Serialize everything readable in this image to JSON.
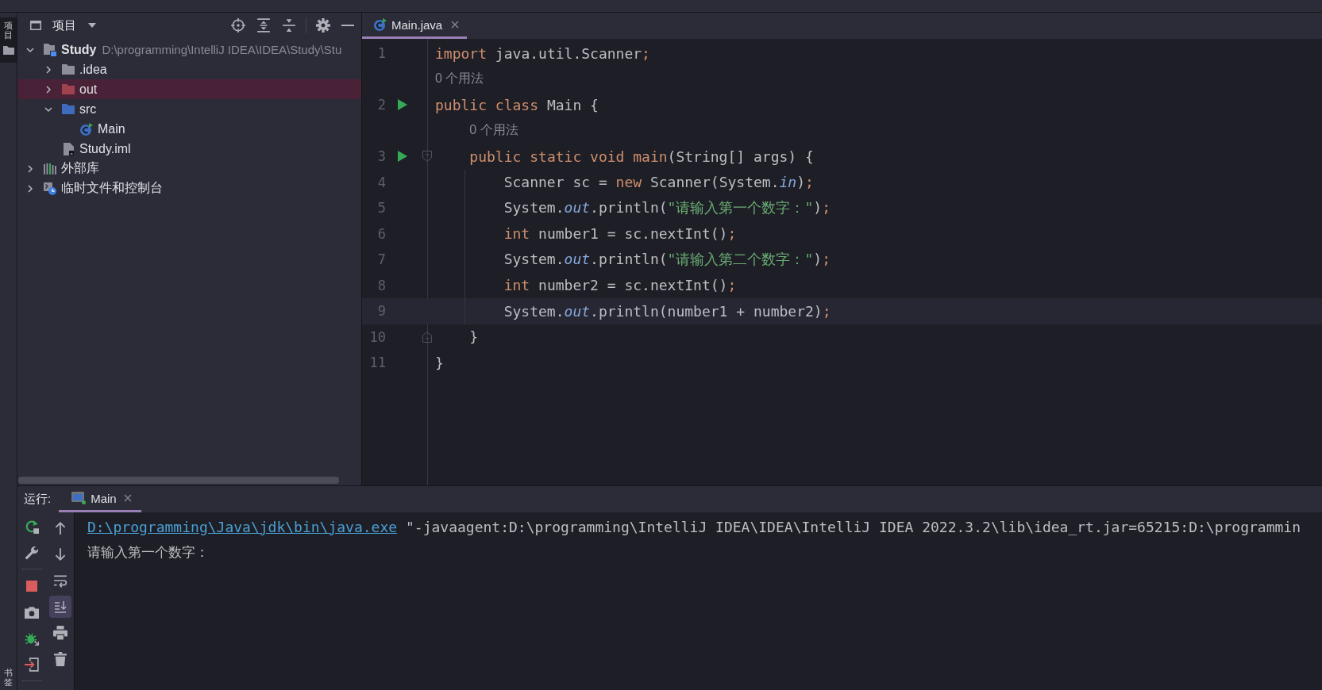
{
  "left_stripe": {
    "project_button": {
      "label": "项目",
      "selected": true
    },
    "bookmarks_button": {
      "label": "书签"
    }
  },
  "project_panel": {
    "title": "项目",
    "tree": [
      {
        "kind": "module",
        "label": "Study",
        "detail": "D:\\programming\\IntelliJ IDEA\\IDEA\\Study\\Stu",
        "expanded": true,
        "selected": false,
        "children": [
          {
            "kind": "folder",
            "label": ".idea",
            "expanded": false,
            "selected": false
          },
          {
            "kind": "excluded-folder",
            "label": "out",
            "expanded": false,
            "selected": true
          },
          {
            "kind": "source-folder",
            "label": "src",
            "expanded": true,
            "selected": false,
            "children": [
              {
                "kind": "class",
                "label": "Main",
                "selected": false
              }
            ]
          },
          {
            "kind": "module-file",
            "label": "Study.iml",
            "selected": false
          }
        ]
      },
      {
        "kind": "libraries",
        "label": "外部库",
        "expanded": false,
        "selected": false
      },
      {
        "kind": "scratches",
        "label": "临时文件和控制台",
        "expanded": false,
        "selected": false
      }
    ]
  },
  "editor": {
    "tabs": [
      {
        "label": "Main.java",
        "selected": true
      }
    ],
    "lines": [
      {
        "kind": "code",
        "number": "1",
        "run": false,
        "current": false,
        "fold_start": false,
        "fold_end": false,
        "tokens": [
          {
            "kind": "keyword",
            "text": "import"
          },
          {
            "kind": "plain",
            "text": " java.util.Scanner"
          },
          {
            "kind": "punct",
            "text": ";"
          }
        ]
      },
      {
        "kind": "hint",
        "text": "0 个用法"
      },
      {
        "kind": "code",
        "number": "2",
        "run": true,
        "current": false,
        "fold_start": false,
        "fold_end": false,
        "tokens": [
          {
            "kind": "keyword",
            "text": "public class"
          },
          {
            "kind": "plain",
            "text": " Main {"
          }
        ],
        "children": [
          {
            "kind": "hint",
            "text": "0 个用法"
          },
          {
            "kind": "code",
            "number": "3",
            "run": true,
            "current": false,
            "fold_start": true,
            "fold_end": false,
            "tokens": [
              {
                "kind": "keyword",
                "text": "public static void main"
              },
              {
                "kind": "plain",
                "text": "(String[] args) {"
              }
            ],
            "children": [
              {
                "kind": "code",
                "number": "4",
                "run": false,
                "current": false,
                "fold_start": false,
                "fold_end": false,
                "tokens": [
                  {
                    "kind": "plain",
                    "text": "Scanner sc = "
                  },
                  {
                    "kind": "keyword",
                    "text": "new"
                  },
                  {
                    "kind": "plain",
                    "text": " Scanner(System."
                  },
                  {
                    "kind": "field",
                    "text": "in"
                  },
                  {
                    "kind": "plain",
                    "text": ")"
                  },
                  {
                    "kind": "punct",
                    "text": ";"
                  }
                ]
              },
              {
                "kind": "code",
                "number": "5",
                "run": false,
                "current": false,
                "fold_start": false,
                "fold_end": false,
                "tokens": [
                  {
                    "kind": "plain",
                    "text": "System."
                  },
                  {
                    "kind": "field",
                    "text": "out"
                  },
                  {
                    "kind": "plain",
                    "text": ".println("
                  },
                  {
                    "kind": "string",
                    "text": "\"请输入第一个数字：\""
                  },
                  {
                    "kind": "plain",
                    "text": ")"
                  },
                  {
                    "kind": "punct",
                    "text": ";"
                  }
                ]
              },
              {
                "kind": "code",
                "number": "6",
                "run": false,
                "current": false,
                "fold_start": false,
                "fold_end": false,
                "tokens": [
                  {
                    "kind": "keyword",
                    "text": "int"
                  },
                  {
                    "kind": "plain",
                    "text": " number1 = sc.nextInt()"
                  },
                  {
                    "kind": "punct",
                    "text": ";"
                  }
                ]
              },
              {
                "kind": "code",
                "number": "7",
                "run": false,
                "current": false,
                "fold_start": false,
                "fold_end": false,
                "tokens": [
                  {
                    "kind": "plain",
                    "text": "System."
                  },
                  {
                    "kind": "field",
                    "text": "out"
                  },
                  {
                    "kind": "plain",
                    "text": ".println("
                  },
                  {
                    "kind": "string",
                    "text": "\"请输入第二个数字：\""
                  },
                  {
                    "kind": "plain",
                    "text": ")"
                  },
                  {
                    "kind": "punct",
                    "text": ";"
                  }
                ]
              },
              {
                "kind": "code",
                "number": "8",
                "run": false,
                "current": false,
                "fold_start": false,
                "fold_end": false,
                "tokens": [
                  {
                    "kind": "keyword",
                    "text": "int"
                  },
                  {
                    "kind": "plain",
                    "text": " number2 = sc.nextInt()"
                  },
                  {
                    "kind": "punct",
                    "text": ";"
                  }
                ]
              },
              {
                "kind": "code",
                "number": "9",
                "run": false,
                "current": true,
                "fold_start": false,
                "fold_end": false,
                "tokens": [
                  {
                    "kind": "plain",
                    "text": "System."
                  },
                  {
                    "kind": "field",
                    "text": "out"
                  },
                  {
                    "kind": "plain",
                    "text": ".println(number1 + number2)"
                  },
                  {
                    "kind": "punct",
                    "text": ";"
                  }
                ]
              }
            ]
          },
          {
            "kind": "code",
            "number": "10",
            "run": false,
            "current": false,
            "fold_start": false,
            "fold_end": true,
            "tokens": [
              {
                "kind": "plain",
                "text": "}"
              }
            ]
          }
        ]
      },
      {
        "kind": "code",
        "number": "11",
        "run": false,
        "current": false,
        "fold_start": false,
        "fold_end": false,
        "tokens": [
          {
            "kind": "plain",
            "text": "}"
          }
        ]
      }
    ]
  },
  "run_panel": {
    "label": "运行:",
    "tabs": [
      {
        "label": "Main",
        "selected": true
      }
    ],
    "toolbar": [
      {
        "kind": "up",
        "on": false
      },
      {
        "kind": "down",
        "on": false
      },
      {
        "kind": "soft-wrap",
        "on": false
      },
      {
        "kind": "scroll-to-end",
        "on": true
      },
      {
        "kind": "print",
        "on": false
      },
      {
        "kind": "clear",
        "on": false
      }
    ],
    "console": [
      {
        "kind": "command",
        "link": "D:\\programming\\Java\\jdk\\bin\\java.exe",
        "text": "\"-javaagent:D:\\programming\\IntelliJ IDEA\\IDEA\\IntelliJ IDEA 2022.3.2\\lib\\idea_rt.jar=65215:D:\\programmin"
      },
      {
        "kind": "output",
        "text": "请输入第一个数字："
      }
    ]
  }
}
